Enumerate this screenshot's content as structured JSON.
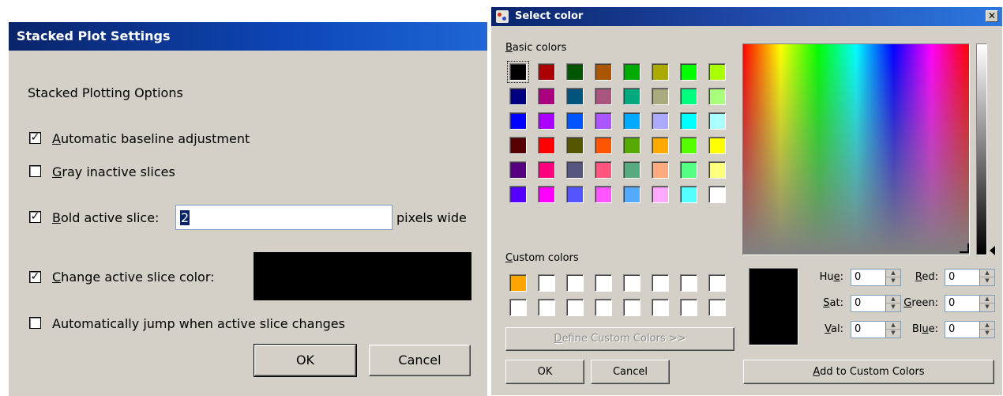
{
  "stacked_dialog": {
    "title": "Stacked Plot Settings",
    "section_label": "Stacked Plotting Options",
    "options": [
      {
        "mnemonic": "A",
        "rest": "utomatic baseline adjustment",
        "checked": true
      },
      {
        "mnemonic": "G",
        "rest": "ray inactive slices",
        "checked": false
      },
      {
        "mnemonic": "B",
        "rest": "old active slice:",
        "checked": true
      },
      {
        "mnemonic": "C",
        "rest": "hange active slice color:",
        "checked": true
      },
      {
        "pre": "Automatically ",
        "mnemonic": "j",
        "rest": "ump when active slice changes",
        "checked": false
      }
    ],
    "bold_width_value": "2",
    "pixels_wide_label": "pixels wide",
    "active_slice_color": "#000000",
    "ok_label": "OK",
    "cancel_label": "Cancel"
  },
  "color_dialog": {
    "title": "Select color",
    "close_glyph": "✕",
    "basic_colors_label": {
      "mnemonic": "B",
      "rest": "asic colors"
    },
    "basic_colors": [
      "#000000",
      "#aa0000",
      "#005500",
      "#aa5500",
      "#00aa00",
      "#aaaa00",
      "#00ff00",
      "#aaff00",
      "#00007f",
      "#aa007f",
      "#00557f",
      "#aa557f",
      "#00aa7f",
      "#aaaa7f",
      "#00ff7f",
      "#aaff7f",
      "#0000ff",
      "#aa00ff",
      "#0055ff",
      "#aa55ff",
      "#00aaff",
      "#aaaaff",
      "#00ffff",
      "#aaffff",
      "#550000",
      "#ff0000",
      "#555500",
      "#ff5500",
      "#55aa00",
      "#ffaa00",
      "#55ff00",
      "#ffff00",
      "#55007f",
      "#ff007f",
      "#55557f",
      "#ff557f",
      "#55aa7f",
      "#ffaa7f",
      "#55ff7f",
      "#ffff7f",
      "#5500ff",
      "#ff00ff",
      "#5555ff",
      "#ff55ff",
      "#55aaff",
      "#ffaaff",
      "#55ffff",
      "#ffffff"
    ],
    "custom_colors_label": {
      "mnemonic": "C",
      "rest": "ustom colors"
    },
    "custom_colors": [
      "#ffa500",
      "#ffffff",
      "#ffffff",
      "#ffffff",
      "#ffffff",
      "#ffffff",
      "#ffffff",
      "#ffffff",
      "#ffffff",
      "#ffffff",
      "#ffffff",
      "#ffffff",
      "#ffffff",
      "#ffffff",
      "#ffffff",
      "#ffffff"
    ],
    "define_custom_label": {
      "mnemonic": "D",
      "rest": "efine Custom Colors >>"
    },
    "ok_label": "OK",
    "cancel_label": "Cancel",
    "add_custom_label": {
      "mnemonic": "A",
      "rest": "dd to Custom Colors"
    },
    "current_color": "#000000",
    "fields": {
      "hue": {
        "pre": "Hu",
        "mnemonic": "e",
        "post": ":",
        "value": "0"
      },
      "sat": {
        "pre": "",
        "mnemonic": "S",
        "post": "at:",
        "value": "0"
      },
      "val": {
        "pre": "",
        "mnemonic": "V",
        "post": "al:",
        "value": "0"
      },
      "red": {
        "pre": "",
        "mnemonic": "R",
        "post": "ed:",
        "value": "0"
      },
      "green": {
        "pre": "",
        "mnemonic": "G",
        "post": "reen:",
        "value": "0"
      },
      "blue": {
        "pre": "Bl",
        "mnemonic": "u",
        "post": "e:",
        "value": "0"
      }
    }
  }
}
